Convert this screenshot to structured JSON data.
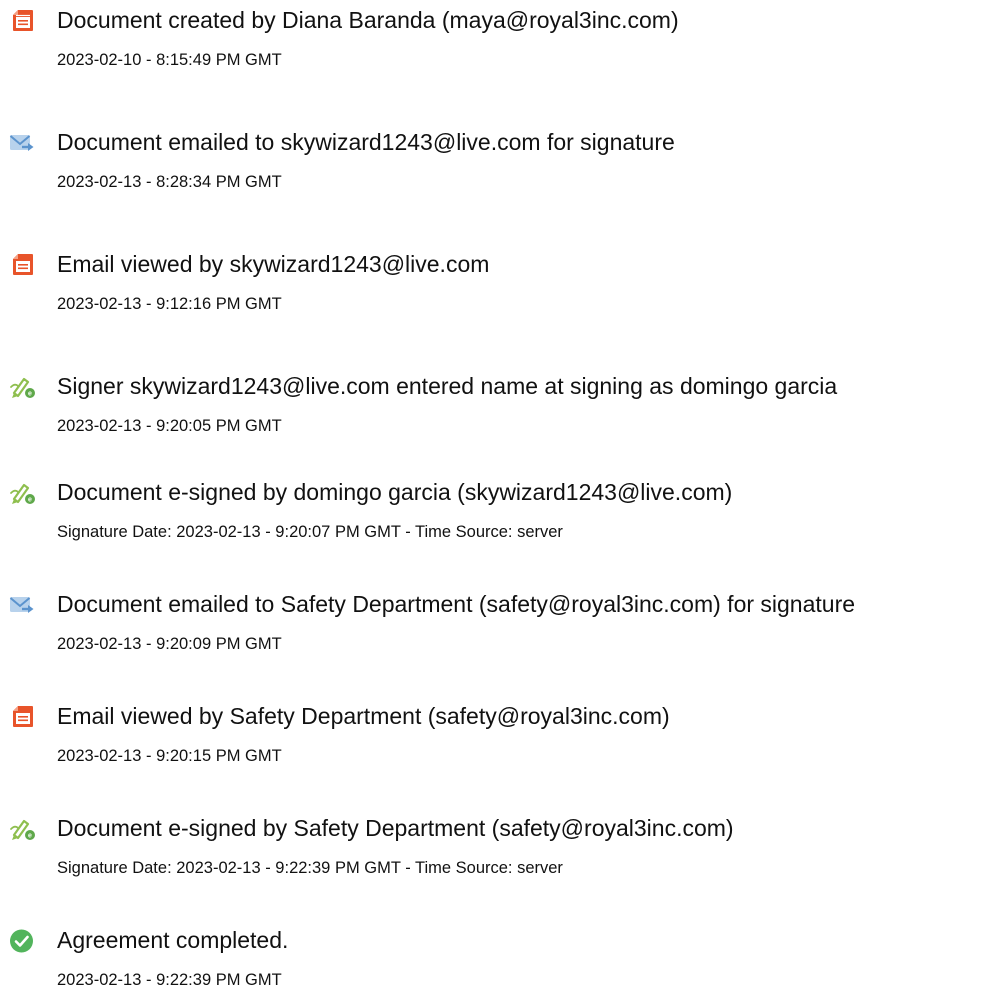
{
  "audit_events": [
    {
      "icon": "document-created-icon",
      "title": "Document created by Diana Baranda (maya@royal3inc.com)",
      "detail": "2023-02-10 - 8:15:49 PM GMT"
    },
    {
      "icon": "email-sent-icon",
      "title": "Document emailed to skywizard1243@live.com for signature",
      "detail": "2023-02-13 - 8:28:34 PM GMT"
    },
    {
      "icon": "document-viewed-icon",
      "title": "Email viewed by skywizard1243@live.com",
      "detail": "2023-02-13 - 9:12:16 PM GMT"
    },
    {
      "icon": "esign-pen-icon",
      "title": "Signer skywizard1243@live.com entered name at signing as domingo garcia",
      "detail": "2023-02-13 - 9:20:05 PM GMT"
    },
    {
      "icon": "esign-pen-icon",
      "title": "Document e-signed by domingo garcia (skywizard1243@live.com)",
      "detail": "Signature Date: 2023-02-13 - 9:20:07 PM GMT - Time Source: server"
    },
    {
      "icon": "email-sent-icon",
      "title": "Document emailed to Safety Department (safety@royal3inc.com) for signature",
      "detail": "2023-02-13 - 9:20:09 PM GMT"
    },
    {
      "icon": "document-viewed-icon",
      "title": "Email viewed by Safety Department (safety@royal3inc.com)",
      "detail": "2023-02-13 - 9:20:15 PM GMT"
    },
    {
      "icon": "esign-pen-icon",
      "title": "Document e-signed by Safety Department (safety@royal3inc.com)",
      "detail": "Signature Date: 2023-02-13 - 9:22:39 PM GMT - Time Source: server"
    },
    {
      "icon": "agreement-completed-check-icon",
      "title": "Agreement completed.",
      "detail": "2023-02-13 - 9:22:39 PM GMT"
    }
  ],
  "colors": {
    "document_icon": "#e8542a",
    "email_icon_light": "#b8d2ec",
    "email_icon_dark": "#5b93cd",
    "pen_icon": "#8fbf4f",
    "complete_icon": "#52b45c",
    "text": "#111111"
  }
}
